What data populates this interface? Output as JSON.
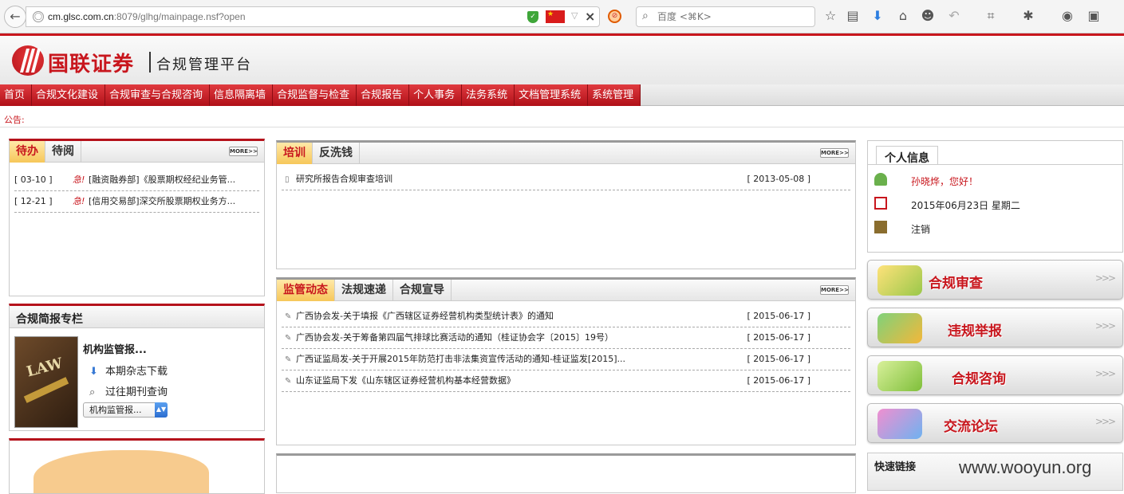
{
  "browser": {
    "url_host": "cm.glsc.com.cn",
    "url_rest": ":8079/glhg/mainpage.nsf?open",
    "search_placeholder": "百度 <⌘K>"
  },
  "header": {
    "brand": "国联证券",
    "subtitle": "合规管理平台"
  },
  "menu": [
    "首页",
    "合规文化建设",
    "合规审查与合规咨询",
    "信息隔离墙",
    "合规监督与检查",
    "合规报告",
    "个人事务",
    "法务系统",
    "文档管理系统",
    "系统管理"
  ],
  "notice": {
    "label": "公告:"
  },
  "more_label": "MORE>>",
  "todo": {
    "tabs": [
      "待办",
      "待阅"
    ],
    "rows": [
      {
        "date": "[ 03-10 ]",
        "flag": "急!",
        "text": "[融资融券部]《股票期权经纪业务管..."
      },
      {
        "date": "[ 12-21 ]",
        "flag": "急!",
        "text": "[信用交易部]深交所股票期权业务方..."
      }
    ]
  },
  "training": {
    "tabs": [
      "培训",
      "反洗钱"
    ],
    "rows": [
      {
        "text": "研究所报告合规审查培训",
        "date": "[ 2013-05-08 ]"
      }
    ]
  },
  "regulation": {
    "tabs": [
      "监管动态",
      "法规速递",
      "合规宣导"
    ],
    "rows": [
      {
        "text": "广西协会发-关于填报《广西辖区证券经营机构类型统计表》的通知",
        "date": "[ 2015-06-17 ]"
      },
      {
        "text": "广西协会发-关于筹备第四届气排球比赛活动的通知（桂证协会字〔2015〕19号）",
        "date": "[ 2015-06-17 ]"
      },
      {
        "text": "广西证监局发-关于开展2015年防范打击非法集资宣传活动的通知-桂证监发[2015]...",
        "date": "[ 2015-06-17 ]"
      },
      {
        "text": "山东证监局下发《山东辖区证券经营机构基本经营数据》",
        "date": "[ 2015-06-17 ]"
      }
    ]
  },
  "brief": {
    "title": "合规简报专栏",
    "item_title": "机构监管报...",
    "download": "本期杂志下载",
    "history": "过往期刊查询",
    "select_value": "机构监管报...",
    "book_text": "LAW"
  },
  "user": {
    "tab": "个人信息",
    "greeting": "孙晓烨，您好！",
    "date": "2015年06月23日 星期二",
    "logout": "注销"
  },
  "quick_buttons": [
    {
      "label": "合规审查"
    },
    {
      "label": "违规举报"
    },
    {
      "label": "合规咨询"
    },
    {
      "label": "交流论坛"
    }
  ],
  "quick_links": {
    "title": "快速链接"
  },
  "watermark": "www.wooyun.org",
  "colors": {
    "brand_red": "#c8161d",
    "tab_active": "#f6c75a"
  }
}
